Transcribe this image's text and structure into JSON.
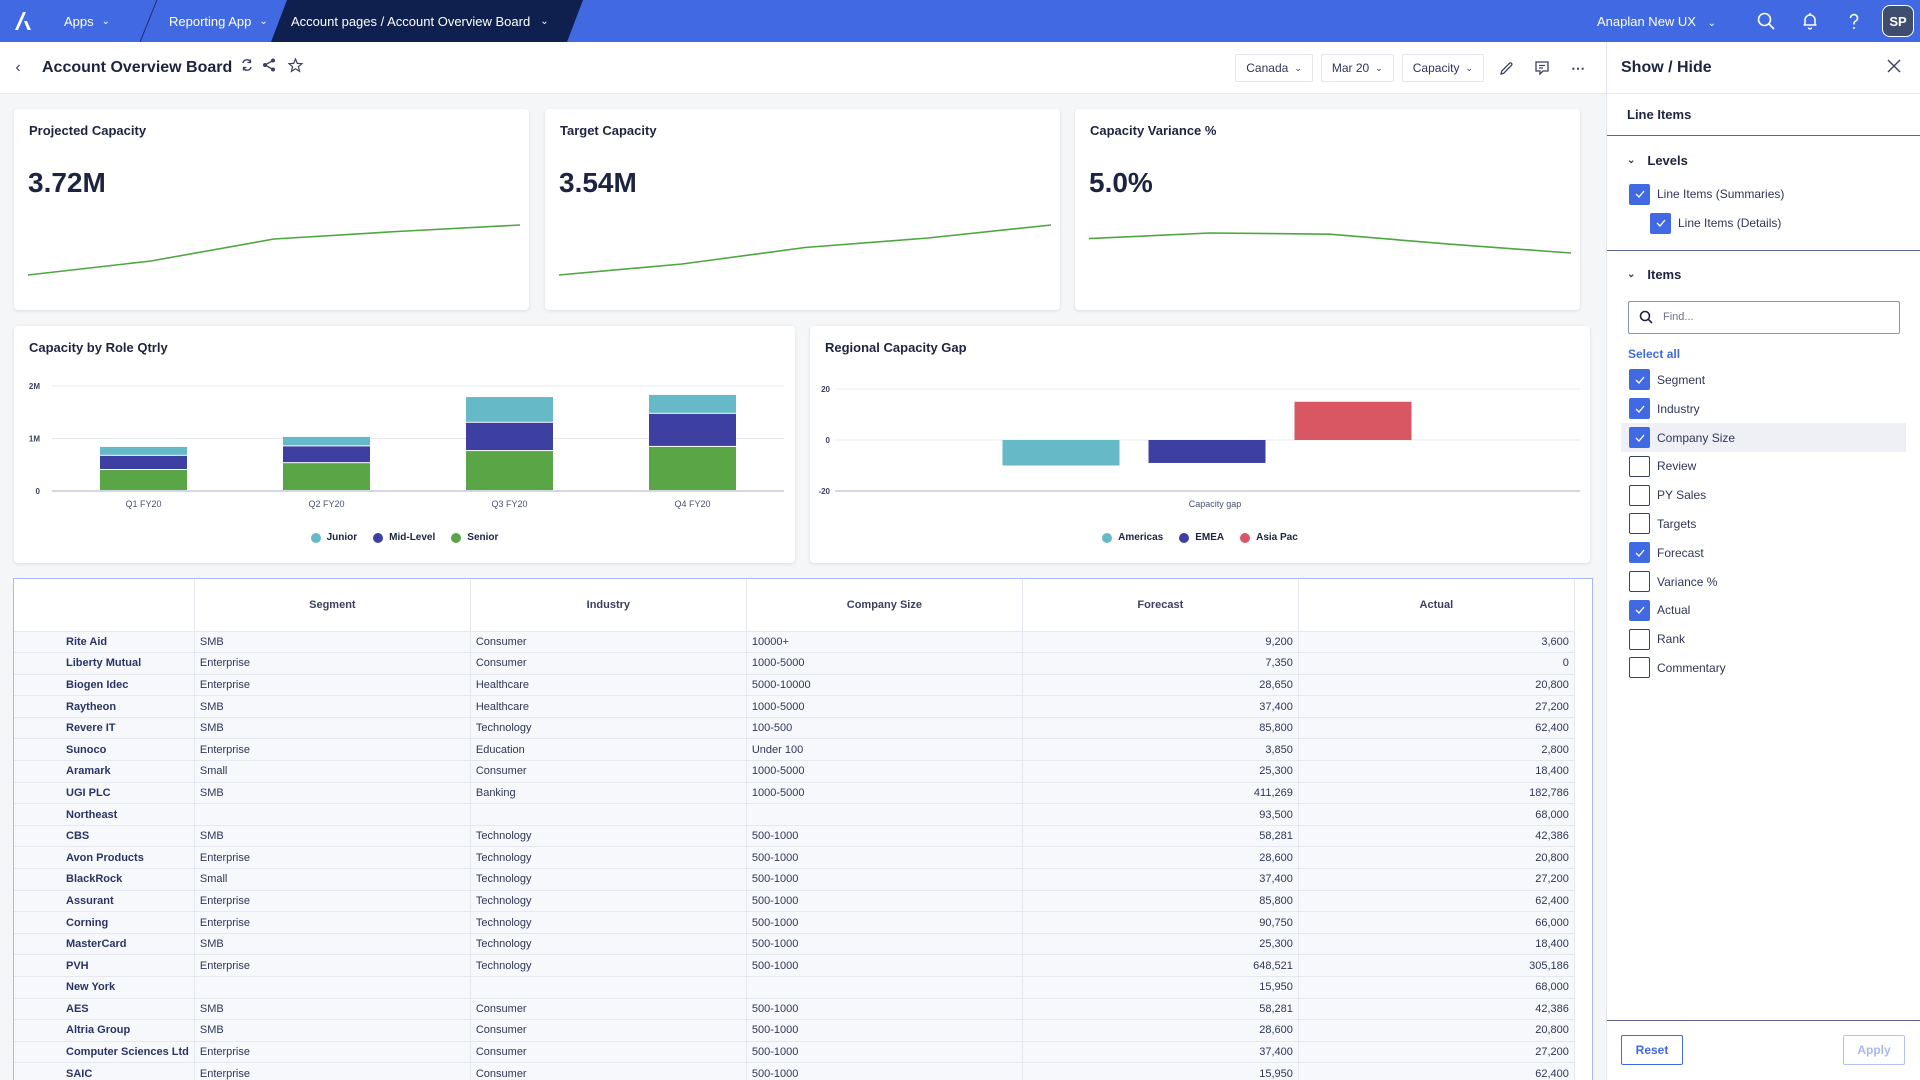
{
  "topbar": {
    "apps_label": "Apps",
    "app_label": "Reporting App",
    "page_path": "Account pages / Account Overview Board",
    "workspace_label": "Anaplan New UX",
    "avatar_initials": "SP",
    "brand_color": "#4169e1",
    "active_crumb_color": "#0f1f4e"
  },
  "header": {
    "title": "Account Overview Board",
    "filters": [
      {
        "label": "Canada"
      },
      {
        "label": "Mar 20"
      },
      {
        "label": "Capacity"
      }
    ]
  },
  "kpis": [
    {
      "title": "Projected Capacity",
      "value": "3.72M",
      "trend": [
        0.0,
        0.28,
        0.72,
        0.87,
        1.0
      ]
    },
    {
      "title": "Target Capacity",
      "value": "3.54M",
      "trend": [
        0.0,
        0.22,
        0.55,
        0.74,
        1.0
      ]
    },
    {
      "title": "Capacity Variance %",
      "value": "5.0%",
      "trend": [
        0.72,
        1.0,
        0.94,
        0.44,
        0.0
      ]
    }
  ],
  "chart_data": [
    {
      "type": "bar",
      "stacked": true,
      "title": "Capacity by Role Qtrly",
      "categories": [
        "Q1 FY20",
        "Q2 FY20",
        "Q3 FY20",
        "Q4 FY20"
      ],
      "series": [
        {
          "name": "Senior",
          "color": "#5aa545",
          "values": [
            400000,
            530000,
            760000,
            840000
          ]
        },
        {
          "name": "Mid-Level",
          "color": "#3d40a0",
          "values": [
            270000,
            320000,
            540000,
            630000
          ]
        },
        {
          "name": "Junior",
          "color": "#66bac8",
          "values": [
            170000,
            180000,
            490000,
            360000
          ]
        }
      ],
      "yticks": [
        "0",
        "1M",
        "2M"
      ],
      "ytick_values": [
        0,
        1000000,
        2000000
      ],
      "ylim": [
        0,
        2000000
      ],
      "grid": true,
      "legend": "bottom",
      "legend_order": [
        "Junior",
        "Mid-Level",
        "Senior"
      ]
    },
    {
      "type": "bar",
      "title": "Regional Capacity Gap",
      "xlabel": "Capacity gap",
      "categories": [
        "Capacity gap"
      ],
      "series": [
        {
          "name": "Americas",
          "color": "#66bac8",
          "values": [
            -10
          ]
        },
        {
          "name": "EMEA",
          "color": "#3d40a0",
          "values": [
            -9
          ]
        },
        {
          "name": "Asia Pac",
          "color": "#d95763",
          "values": [
            15
          ]
        }
      ],
      "yticks": [
        "-20",
        "0",
        "20"
      ],
      "ytick_values": [
        -20,
        0,
        20
      ],
      "ylim": [
        -20,
        20
      ],
      "grid": true,
      "legend": "bottom"
    }
  ],
  "table": {
    "columns": [
      "Segment",
      "Industry",
      "Company Size",
      "Forecast",
      "Actual"
    ],
    "rows": [
      {
        "name": "Rite Aid",
        "segment": "SMB",
        "industry": "Consumer",
        "size": "10000+",
        "forecast": "9,200",
        "actual": "3,600"
      },
      {
        "name": "Liberty Mutual",
        "segment": "Enterprise",
        "industry": "Consumer",
        "size": "1000-5000",
        "forecast": "7,350",
        "actual": "0"
      },
      {
        "name": "Biogen Idec",
        "segment": "Enterprise",
        "industry": "Healthcare",
        "size": "5000-10000",
        "forecast": "28,650",
        "actual": "20,800"
      },
      {
        "name": "Raytheon",
        "segment": "SMB",
        "industry": "Healthcare",
        "size": "1000-5000",
        "forecast": "37,400",
        "actual": "27,200"
      },
      {
        "name": "Revere IT",
        "segment": "SMB",
        "industry": "Technology",
        "size": "100-500",
        "forecast": "85,800",
        "actual": "62,400"
      },
      {
        "name": "Sunoco",
        "segment": "Enterprise",
        "industry": "Education",
        "size": "Under 100",
        "forecast": "3,850",
        "actual": "2,800"
      },
      {
        "name": "Aramark",
        "segment": "Small",
        "industry": "Consumer",
        "size": "1000-5000",
        "forecast": "25,300",
        "actual": "18,400"
      },
      {
        "name": "UGI PLC",
        "segment": "SMB",
        "industry": "Banking",
        "size": "1000-5000",
        "forecast": "411,269",
        "actual": "182,786"
      },
      {
        "name": "Northeast",
        "segment": "",
        "industry": "",
        "size": "",
        "forecast": "93,500",
        "actual": "68,000"
      },
      {
        "name": "CBS",
        "segment": "SMB",
        "industry": "Technology",
        "size": "500-1000",
        "forecast": "58,281",
        "actual": "42,386"
      },
      {
        "name": "Avon Products",
        "segment": "Enterprise",
        "industry": "Technology",
        "size": "500-1000",
        "forecast": "28,600",
        "actual": "20,800"
      },
      {
        "name": "BlackRock",
        "segment": "Small",
        "industry": "Technology",
        "size": "500-1000",
        "forecast": "37,400",
        "actual": "27,200"
      },
      {
        "name": "Assurant",
        "segment": "Enterprise",
        "industry": "Technology",
        "size": "500-1000",
        "forecast": "85,800",
        "actual": "62,400"
      },
      {
        "name": "Corning",
        "segment": "Enterprise",
        "industry": "Technology",
        "size": "500-1000",
        "forecast": "90,750",
        "actual": "66,000"
      },
      {
        "name": "MasterCard",
        "segment": "SMB",
        "industry": "Technology",
        "size": "500-1000",
        "forecast": "25,300",
        "actual": "18,400"
      },
      {
        "name": "PVH",
        "segment": "Enterprise",
        "industry": "Technology",
        "size": "500-1000",
        "forecast": "648,521",
        "actual": "305,186"
      },
      {
        "name": "New York",
        "segment": "",
        "industry": "",
        "size": "",
        "forecast": "15,950",
        "actual": "68,000"
      },
      {
        "name": "AES",
        "segment": "SMB",
        "industry": "Consumer",
        "size": "500-1000",
        "forecast": "58,281",
        "actual": "42,386"
      },
      {
        "name": "Altria Group",
        "segment": "SMB",
        "industry": "Consumer",
        "size": "500-1000",
        "forecast": "28,600",
        "actual": "20,800"
      },
      {
        "name": "Computer Sciences Ltd",
        "segment": "Enterprise",
        "industry": "Consumer",
        "size": "500-1000",
        "forecast": "37,400",
        "actual": "27,200"
      },
      {
        "name": "SAIC",
        "segment": "Enterprise",
        "industry": "Consumer",
        "size": "500-1000",
        "forecast": "15,950",
        "actual": "62,400"
      }
    ]
  },
  "panel": {
    "title": "Show / Hide",
    "subtitle": "Line Items",
    "levels_label": "Levels",
    "levels": [
      {
        "label": "Line Items (Summaries)",
        "checked": true
      },
      {
        "label": "Line Items (Details)",
        "checked": true
      }
    ],
    "items_label": "Items",
    "find_placeholder": "Find...",
    "select_all": "Select all",
    "items": [
      {
        "label": "Segment",
        "checked": true
      },
      {
        "label": "Industry",
        "checked": true
      },
      {
        "label": "Company Size",
        "checked": true,
        "highlighted": true
      },
      {
        "label": "Review",
        "checked": false
      },
      {
        "label": "PY Sales",
        "checked": false
      },
      {
        "label": "Targets",
        "checked": false
      },
      {
        "label": "Forecast",
        "checked": true
      },
      {
        "label": "Variance %",
        "checked": false
      },
      {
        "label": "Actual",
        "checked": true
      },
      {
        "label": "Rank",
        "checked": false
      },
      {
        "label": "Commentary",
        "checked": false
      }
    ],
    "reset_label": "Reset",
    "apply_label": "Apply"
  }
}
